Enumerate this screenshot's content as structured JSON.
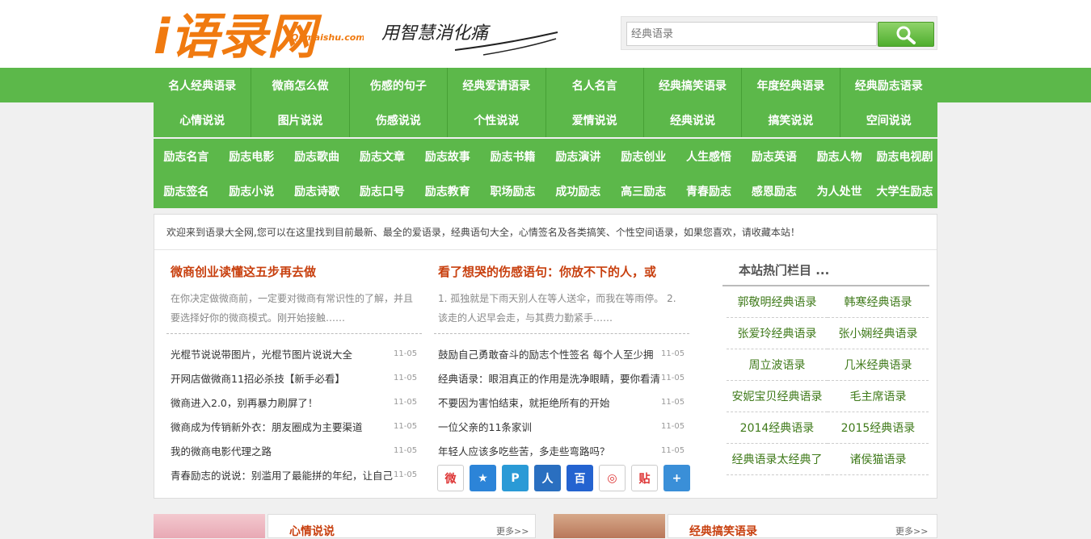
{
  "logo": {
    "main": "i语录网",
    "sub": "Qumaishu.com"
  },
  "slogan": "用智慧消化痛",
  "search": {
    "placeholder": "经典语录"
  },
  "nav_main": [
    [
      "名人经典语录",
      "微商怎么做",
      "伤感的句子",
      "经典爱请语录",
      "名人名言",
      "经典搞笑语录",
      "年度经典语录",
      "经典励志语录"
    ],
    [
      "心情说说",
      "图片说说",
      "伤感说说",
      "个性说说",
      "爱情说说",
      "经典说说",
      "搞笑说说",
      "空间说说"
    ]
  ],
  "nav_sub": [
    [
      "励志名言",
      "励志电影",
      "励志歌曲",
      "励志文章",
      "励志故事",
      "励志书籍",
      "励志演讲",
      "励志创业",
      "人生感悟",
      "励志英语",
      "励志人物",
      "励志电视剧"
    ],
    [
      "励志签名",
      "励志小说",
      "励志诗歌",
      "励志口号",
      "励志教育",
      "职场励志",
      "成功励志",
      "高三励志",
      "青春励志",
      "感恩励志",
      "为人处世",
      "大学生励志"
    ]
  ],
  "welcome": "欢迎来到语录大全网,您可以在这里找到目前最新、最全的爱语录，经典语句大全，心情签名及各类搞笑、个性空间语录，如果您喜欢，请收藏本站！",
  "col1": {
    "title": "微商创业读懂这五步再去做",
    "desc": "在你决定做微商前，一定要对微商有常识性的了解，并且要选择好你的微商模式。刚开始接触……",
    "items": [
      {
        "t": "光棍节说说带图片，光棍节图片说说大全",
        "d": "11-05"
      },
      {
        "t": "开网店做微商11招必杀技【新手必看】",
        "d": "11-05"
      },
      {
        "t": "微商进入2.0，别再暴力刷屏了！",
        "d": "11-05"
      },
      {
        "t": "微商成为传销新外衣：朋友圈成为主要渠道",
        "d": "11-05"
      },
      {
        "t": "我的微商电影代理之路",
        "d": "11-05"
      },
      {
        "t": "青春励志的说说：别滥用了最能拼的年纪，让自己",
        "d": "11-05"
      }
    ]
  },
  "col2": {
    "title": "看了想哭的伤感语句：你放不下的人，或",
    "desc": "1. 孤独就是下雨天别人在等人送伞，而我在等雨停。 2. 该走的人迟早会走，与其费力勤紧手……",
    "items": [
      {
        "t": "鼓励自己勇敢奋斗的励志个性签名 每个人至少拥",
        "d": "11-05"
      },
      {
        "t": "经典语录：眼泪真正的作用是洗净眼睛，要你看清",
        "d": "11-05"
      },
      {
        "t": "不要因为害怕结束，就拒绝所有的开始",
        "d": "11-05"
      },
      {
        "t": "一位父亲的11条家训",
        "d": "11-05"
      },
      {
        "t": "年轻人应该多吃些苦，多走些弯路吗？",
        "d": "11-05"
      }
    ]
  },
  "hot": {
    "title": "本站热门栏目 ...",
    "items": [
      "郭敬明经典语录",
      "韩寒经典语录",
      "张爱玲经典语录",
      "张小娴经典语录",
      "周立波语录",
      "几米经典语录",
      "安妮宝贝经典语录",
      "毛主席语录",
      "2014经典语录",
      "2015经典语录",
      "经典语录太经典了",
      "诸侯猫语录"
    ]
  },
  "shares": [
    {
      "name": "weibo-icon",
      "color": "#ffffff",
      "glyph": "微"
    },
    {
      "name": "qzone-icon",
      "color": "#2c84d8",
      "glyph": "★"
    },
    {
      "name": "tqq-icon",
      "color": "#2a9ad6",
      "glyph": "P"
    },
    {
      "name": "renren-icon",
      "color": "#2a6fc0",
      "glyph": "人"
    },
    {
      "name": "baidu-icon",
      "color": "#2463d0",
      "glyph": "百"
    },
    {
      "name": "qq-icon",
      "color": "#ffffff",
      "glyph": "◎"
    },
    {
      "name": "tieba-icon",
      "color": "#ffffff",
      "glyph": "贴"
    },
    {
      "name": "more-share-icon",
      "color": "#3a8fd8",
      "glyph": "+"
    }
  ],
  "bottom": {
    "left_title": "心情说说",
    "right_title": "经典搞笑语录",
    "more": "更多>>"
  }
}
